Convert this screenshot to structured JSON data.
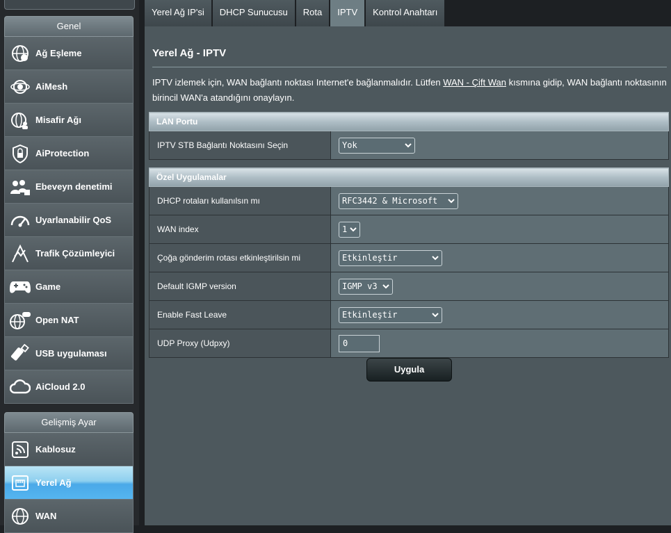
{
  "sidebar": {
    "general": {
      "title": "Genel",
      "items": [
        {
          "label": "Ağ Eşleme",
          "icon": "network-map-icon"
        },
        {
          "label": "AiMesh",
          "icon": "aimesh-icon"
        },
        {
          "label": "Misafir Ağı",
          "icon": "guest-network-icon"
        },
        {
          "label": "AiProtection",
          "icon": "shield-lock-icon"
        },
        {
          "label": "Ebeveyn denetimi",
          "icon": "parental-control-icon"
        },
        {
          "label": "Uyarlanabilir QoS",
          "icon": "speedometer-icon"
        },
        {
          "label": "Trafik Çözümleyici",
          "icon": "traffic-analyzer-icon"
        },
        {
          "label": "Game",
          "icon": "gamepad-icon"
        },
        {
          "label": "Open NAT",
          "icon": "open-nat-icon"
        },
        {
          "label": "USB uygulaması",
          "icon": "usb-icon"
        },
        {
          "label": "AiCloud 2.0",
          "icon": "cloud-icon"
        }
      ]
    },
    "advanced": {
      "title": "Gelişmiş Ayar",
      "items": [
        {
          "label": "Kablosuz",
          "icon": "wireless-icon",
          "active": false
        },
        {
          "label": "Yerel Ağ",
          "icon": "lan-icon",
          "active": true
        },
        {
          "label": "WAN",
          "icon": "globe-icon",
          "active": false
        }
      ]
    }
  },
  "tabs": [
    {
      "label": "Yerel Ağ IP'si",
      "active": false
    },
    {
      "label": "DHCP Sunucusu",
      "active": false
    },
    {
      "label": "Rota",
      "active": false
    },
    {
      "label": "IPTV",
      "active": true
    },
    {
      "label": "Kontrol Anahtarı",
      "active": false
    }
  ],
  "page": {
    "title": "Yerel Ağ - IPTV",
    "desc_before": "IPTV izlemek için, WAN bağlantı noktası Internet'e bağlanmalıdır. Lütfen ",
    "desc_link": "WAN - Çift Wan",
    "desc_after": " kısmına gidip, WAN bağlantı noktasının birincil WAN'a atandığını onaylayın."
  },
  "lan_port": {
    "header": "LAN Portu",
    "stb_label": "IPTV STB Bağlantı Noktasını Seçin",
    "stb_value": "Yok"
  },
  "special_apps": {
    "header": "Özel Uygulamalar",
    "dhcp_routes_label": "DHCP rotaları kullanılsın mı",
    "dhcp_routes_value": "RFC3442 & Microsoft",
    "wan_index_label": "WAN index",
    "wan_index_value": "1",
    "multicast_label": "Çoğa gönderim rotası etkinleştirilsin mi",
    "multicast_value": "Etkinleştir",
    "igmp_label": "Default IGMP version",
    "igmp_value": "IGMP v3",
    "fast_leave_label": "Enable Fast Leave",
    "fast_leave_value": "Etkinleştir",
    "udpxy_label": "UDP Proxy (Udpxy)",
    "udpxy_value": "0"
  },
  "apply_label": "Uygula",
  "colors": {
    "active_menu": "#4aa9e8",
    "panel": "#4d585d",
    "sidebar": "#26292c"
  }
}
